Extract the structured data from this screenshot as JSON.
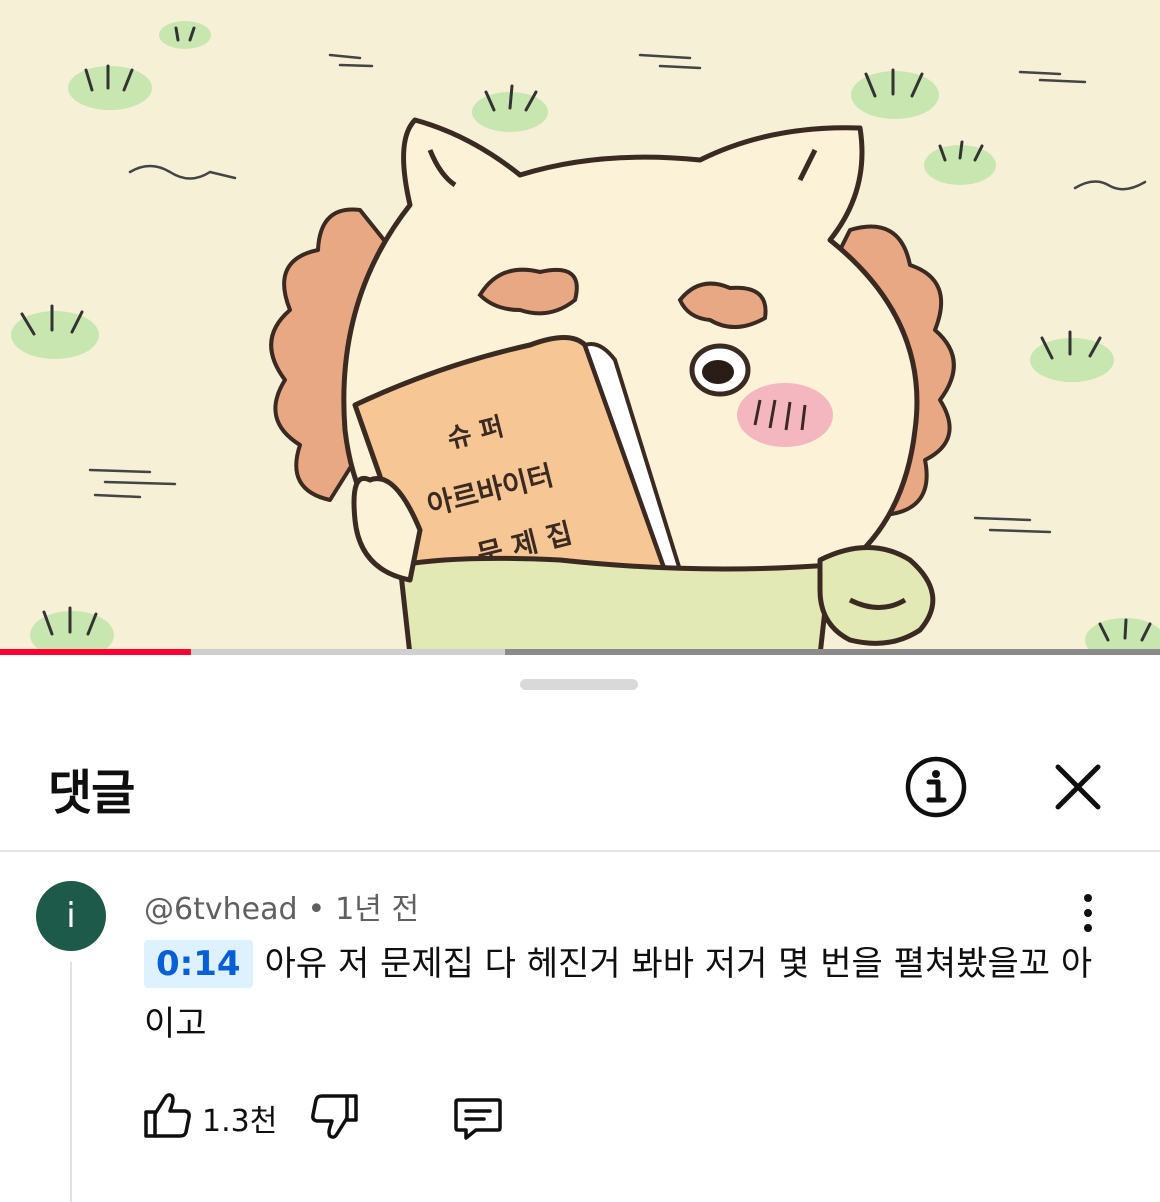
{
  "video": {
    "progress_played": 0.165,
    "progress_buffered": 0.435,
    "book_lines": [
      "슈 퍼",
      "아르바이터",
      "문 제 집"
    ]
  },
  "sheet": {
    "title": "댓글",
    "info_icon": "info-circle-icon",
    "close_icon": "close-icon"
  },
  "comment": {
    "avatar_letter": "i",
    "author": "@6tvhead",
    "separator": "•",
    "time": "1년 전",
    "timestamp": "0:14",
    "text": "아유 저 문제집 다 헤진거 봐바 저거 몇 번을 펼쳐봤을꼬 아이고",
    "likes": "1.3천",
    "icons": {
      "like": "thumbs-up-icon",
      "dislike": "thumbs-down-icon",
      "reply": "reply-icon",
      "more": "more-vertical-icon"
    }
  },
  "colors": {
    "progress": "#ff0033",
    "avatar": "#1e5a4a",
    "timestamp_text": "#065fd4",
    "timestamp_bg": "#def1ff",
    "video_bg": "#f6f0d7"
  }
}
